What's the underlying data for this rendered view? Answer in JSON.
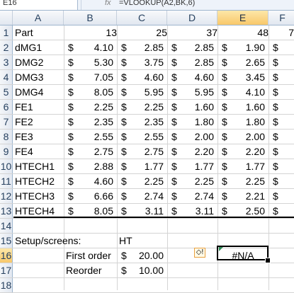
{
  "formula_bar": {
    "name_box": "E16",
    "fx_label": "fx",
    "formula": "=VLOOKUP(A2,BK,6)"
  },
  "columns": [
    "A",
    "B",
    "C",
    "D",
    "E",
    "F"
  ],
  "rows": [
    {
      "n": "1",
      "label": "Part",
      "header": [
        "13",
        "25",
        "37",
        "48",
        "7"
      ]
    },
    {
      "n": "2",
      "label": "dMG1",
      "vals": [
        "4.10",
        "2.85",
        "2.85",
        "1.90"
      ]
    },
    {
      "n": "3",
      "label": "DMG2",
      "vals": [
        "5.30",
        "3.75",
        "2.85",
        "2.65"
      ]
    },
    {
      "n": "4",
      "label": "DMG3",
      "vals": [
        "7.05",
        "4.60",
        "4.60",
        "3.45"
      ]
    },
    {
      "n": "5",
      "label": "DMG4",
      "vals": [
        "8.05",
        "5.95",
        "5.95",
        "4.10"
      ]
    },
    {
      "n": "6",
      "label": "FE1",
      "vals": [
        "2.25",
        "2.25",
        "1.60",
        "1.60"
      ]
    },
    {
      "n": "7",
      "label": "FE2",
      "vals": [
        "2.35",
        "2.35",
        "1.80",
        "1.80"
      ]
    },
    {
      "n": "8",
      "label": "FE3",
      "vals": [
        "2.55",
        "2.55",
        "2.00",
        "2.00"
      ]
    },
    {
      "n": "9",
      "label": "FE4",
      "vals": [
        "2.75",
        "2.75",
        "2.20",
        "2.20"
      ]
    },
    {
      "n": "10",
      "label": "HTECH1",
      "vals": [
        "2.88",
        "1.77",
        "1.77",
        "1.77"
      ]
    },
    {
      "n": "11",
      "label": "HTECH2",
      "vals": [
        "4.60",
        "2.25",
        "2.25",
        "2.25"
      ]
    },
    {
      "n": "12",
      "label": "HTECH3",
      "vals": [
        "6.66",
        "2.74",
        "2.74",
        "2.21"
      ]
    },
    {
      "n": "13",
      "label": "HTECH4",
      "vals": [
        "8.05",
        "3.11",
        "3.11",
        "2.50"
      ]
    },
    {
      "n": "14"
    },
    {
      "n": "15",
      "label": "Setup/screens:",
      "c_text": "HT"
    },
    {
      "n": "16",
      "b_text": "First order",
      "c_dollar": "$",
      "c_val": "20.00",
      "e_text": "#N/A"
    },
    {
      "n": "17",
      "b_text": "Reorder",
      "c_dollar": "$",
      "c_val": "10.00"
    },
    {
      "n": "18"
    }
  ],
  "currency_symbol": "$",
  "error_button_icon": "warning-icon",
  "colors": {
    "selected_header": "#f8c86a",
    "grid": "#d4d4d4",
    "error_triangle": "#2e8b57"
  }
}
